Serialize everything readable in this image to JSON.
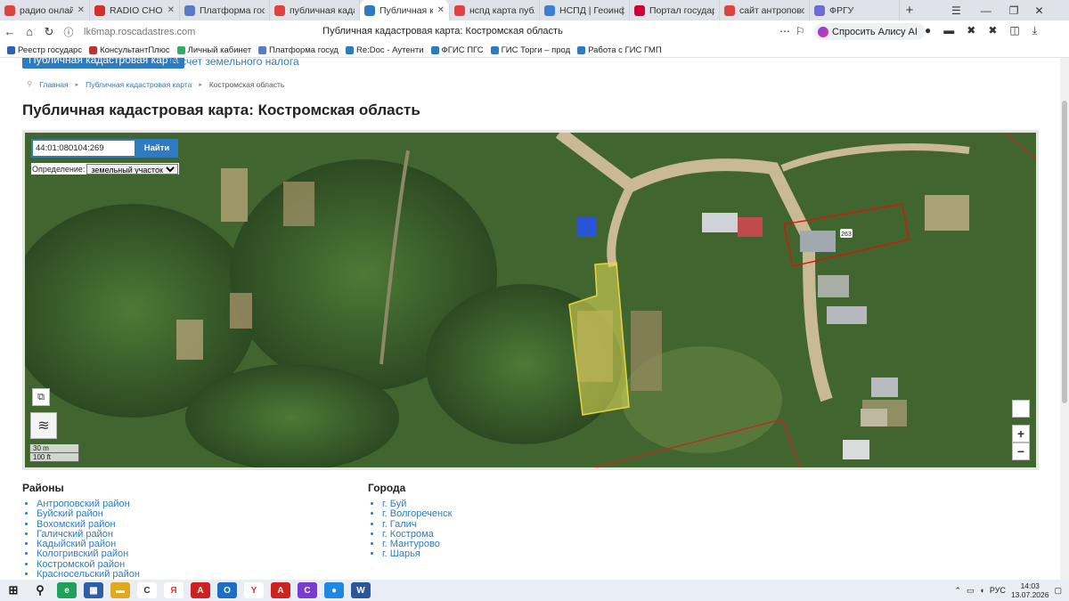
{
  "browser": {
    "tabs": [
      {
        "label": "радио онлайн — Я",
        "color": "#e04141",
        "active": false
      },
      {
        "label": "RADIO CHOC",
        "color": "#d62d2d",
        "active": false
      },
      {
        "label": "Платформа госуда",
        "color": "#5a7bc6",
        "active": false
      },
      {
        "label": "публичная кадаст",
        "color": "#e04141",
        "active": false
      },
      {
        "label": "Публичная кадаст",
        "color": "#2f7bc1",
        "active": true
      },
      {
        "label": "нспд карта публич",
        "color": "#e04141",
        "active": false
      },
      {
        "label": "НСПД | Геоинформ",
        "color": "#3a7fd0",
        "active": false
      },
      {
        "label": "Портал государств",
        "color": "#c03",
        "active": false
      },
      {
        "label": "сайт антропово —",
        "color": "#e04141",
        "active": false
      },
      {
        "label": "ФРГУ",
        "color": "#6e6ad6",
        "active": false
      }
    ],
    "url": "lk6map.roscadastres.com",
    "page_title": "Публичная кадастровая карта: Костромская область",
    "alice_label": "Спросить Алису AI",
    "bookmarks": [
      {
        "label": "Реестр государс",
        "color": "#2f5fb1"
      },
      {
        "label": "КонсультантПлюс",
        "color": "#b33"
      },
      {
        "label": "Личный кабинет",
        "color": "#3a6"
      },
      {
        "label": "Платформа госуд",
        "color": "#5a7bc6"
      },
      {
        "label": "Re:Doc - Аутенти",
        "color": "#2f7bc1"
      },
      {
        "label": "ФГИС ПГС",
        "color": "#2f7bc1"
      },
      {
        "label": "ГИС Торги – прод",
        "color": "#2f7bc1"
      },
      {
        "label": "Работа с ГИС ГМП",
        "color": "#2f7bc1"
      }
    ]
  },
  "site": {
    "top_button": "Публичная кадастровая карта",
    "top_link": "Расчет земельного налога",
    "breadcrumb": [
      "Главная",
      "Публичная кадастровая карта",
      "Костромская область"
    ],
    "heading": "Публичная кадастровая карта: Костромская область"
  },
  "map": {
    "search_value": "44:01:080104:269",
    "search_button": "Найти",
    "definition_label": "Определение:",
    "definition_value": "земельный участок",
    "parcel_label": "263",
    "scale_metric": "30 m",
    "scale_imperial": "100 ft",
    "zoom_in": "+",
    "zoom_out": "−"
  },
  "lists": {
    "districts_title": "Районы",
    "districts": [
      "Антроповский район",
      "Буйский район",
      "Вохомский район",
      "Галичский район",
      "Кадыйский район",
      "Кологривский район",
      "Костромской район",
      "Красносельский район"
    ],
    "cities_title": "Города",
    "cities": [
      "г. Буй",
      "г. Волгореченск",
      "г. Галич",
      "г. Кострома",
      "г. Мантурово",
      "г. Шарья"
    ]
  },
  "taskbar": {
    "lang": "РУС",
    "time": "14:03",
    "date": "13.07.2026"
  }
}
